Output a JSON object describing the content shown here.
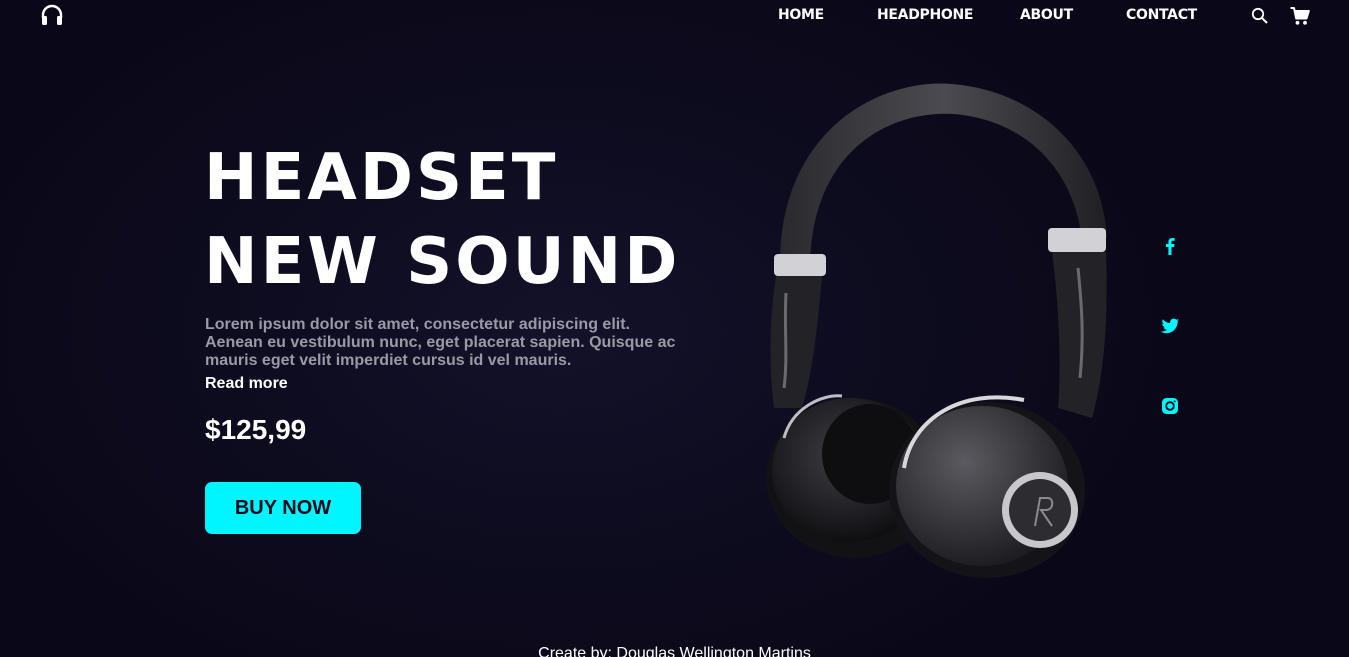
{
  "header": {
    "logo_icon": "headphones-icon",
    "nav": {
      "home": "HOME",
      "headphone": "HEADPHONE",
      "about": "ABOUT",
      "contact": "CONTACT"
    },
    "search_icon": "search-icon",
    "cart_icon": "cart-icon"
  },
  "hero": {
    "title_line1": "HEADSET",
    "title_line2": "NEW SOUND",
    "description": "Lorem ipsum dolor sit amet, consectetur adipiscing elit. Aenean eu vestibulum nunc, eget placerat sapien. Quisque ac mauris eget velit imperdiet cursus id vel mauris.",
    "read_more": "Read more",
    "price": "$125,99",
    "buy_label": "BUY NOW"
  },
  "social": {
    "icons": [
      "facebook-icon",
      "twitter-icon",
      "instagram-icon"
    ]
  },
  "footer": {
    "credit": "Create by: Douglas Wellington Martins"
  },
  "colors": {
    "background": "#0d0b1e",
    "accent": "#00f6ff",
    "text": "#ffffff",
    "muted_text": "#9a9aa6"
  }
}
